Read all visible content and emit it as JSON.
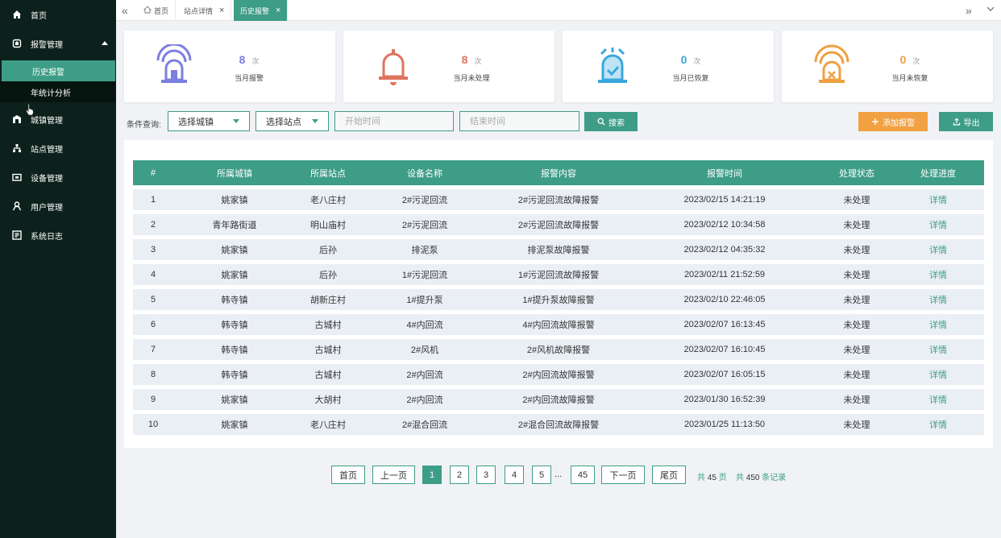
{
  "sidebar": {
    "items": [
      {
        "label": "首页",
        "icon": "home-icon"
      },
      {
        "label": "报警管理",
        "icon": "alarm-icon"
      },
      {
        "label": "城镇管理",
        "icon": "town-icon"
      },
      {
        "label": "站点管理",
        "icon": "site-icon"
      },
      {
        "label": "设备管理",
        "icon": "device-icon"
      },
      {
        "label": "用户管理",
        "icon": "user-icon"
      },
      {
        "label": "系统日志",
        "icon": "log-icon"
      }
    ],
    "submenu": [
      {
        "label": "历史报警"
      },
      {
        "label": "年统计分析"
      }
    ]
  },
  "tabs": [
    {
      "label": "首页"
    },
    {
      "label": "站点详情"
    },
    {
      "label": "历史报警"
    }
  ],
  "stats": [
    {
      "value": "8",
      "unit": "次",
      "label": "当月报警",
      "color": "#7b7fe0"
    },
    {
      "value": "8",
      "unit": "次",
      "label": "当月未处理",
      "color": "#e0735e"
    },
    {
      "value": "0",
      "unit": "次",
      "label": "当月已恢复",
      "color": "#3aa8dc"
    },
    {
      "value": "0",
      "unit": "次",
      "label": "当月未恢复",
      "color": "#eea040"
    }
  ],
  "filters": {
    "label": "条件查询:",
    "city": "选择城镇",
    "site": "选择站点",
    "start_placeholder": "开始时间",
    "end_placeholder": "结束时间",
    "search": "搜索",
    "add": "添加报警",
    "export": "导出"
  },
  "table": {
    "headers": [
      "#",
      "所属城镇",
      "所属站点",
      "设备名称",
      "报警内容",
      "报警时间",
      "处理状态",
      "处理进度"
    ],
    "rows": [
      [
        "1",
        "姚家镇",
        "老八庄村",
        "2#污泥回流",
        "2#污泥回流故障报警",
        "2023/02/15 14:21:19",
        "未处理",
        "详情"
      ],
      [
        "2",
        "青年路街道",
        "明山庙村",
        "2#污泥回流",
        "2#污泥回流故障报警",
        "2023/02/12 10:34:58",
        "未处理",
        "详情"
      ],
      [
        "3",
        "姚家镇",
        "后孙",
        "排泥泵",
        "排泥泵故障报警",
        "2023/02/12 04:35:32",
        "未处理",
        "详情"
      ],
      [
        "4",
        "姚家镇",
        "后孙",
        "1#污泥回流",
        "1#污泥回流故障报警",
        "2023/02/11 21:52:59",
        "未处理",
        "详情"
      ],
      [
        "5",
        "韩寺镇",
        "胡新庄村",
        "1#提升泵",
        "1#提升泵故障报警",
        "2023/02/10 22:46:05",
        "未处理",
        "详情"
      ],
      [
        "6",
        "韩寺镇",
        "古城村",
        "4#内回流",
        "4#内回流故障报警",
        "2023/02/07 16:13:45",
        "未处理",
        "详情"
      ],
      [
        "7",
        "韩寺镇",
        "古城村",
        "2#风机",
        "2#风机故障报警",
        "2023/02/07 16:10:45",
        "未处理",
        "详情"
      ],
      [
        "8",
        "韩寺镇",
        "古城村",
        "2#内回流",
        "2#内回流故障报警",
        "2023/02/07 16:05:15",
        "未处理",
        "详情"
      ],
      [
        "9",
        "姚家镇",
        "大胡村",
        "2#内回流",
        "2#内回流故障报警",
        "2023/01/30 16:52:39",
        "未处理",
        "详情"
      ],
      [
        "10",
        "姚家镇",
        "老八庄村",
        "2#混合回流",
        "2#混合回流故障报警",
        "2023/01/25 11:13:50",
        "未处理",
        "详情"
      ]
    ]
  },
  "pagination": {
    "first": "首页",
    "prev": "上一页",
    "pages": [
      "1",
      "2",
      "3",
      "4",
      "5"
    ],
    "dots": "...",
    "last_page": "45",
    "next": "下一页",
    "last": "尾页",
    "total_pages_prefix": "共",
    "total_pages": "45",
    "total_pages_suffix": "页",
    "total_records_prefix": "共",
    "total_records": "450",
    "total_records_suffix": "条记录"
  }
}
